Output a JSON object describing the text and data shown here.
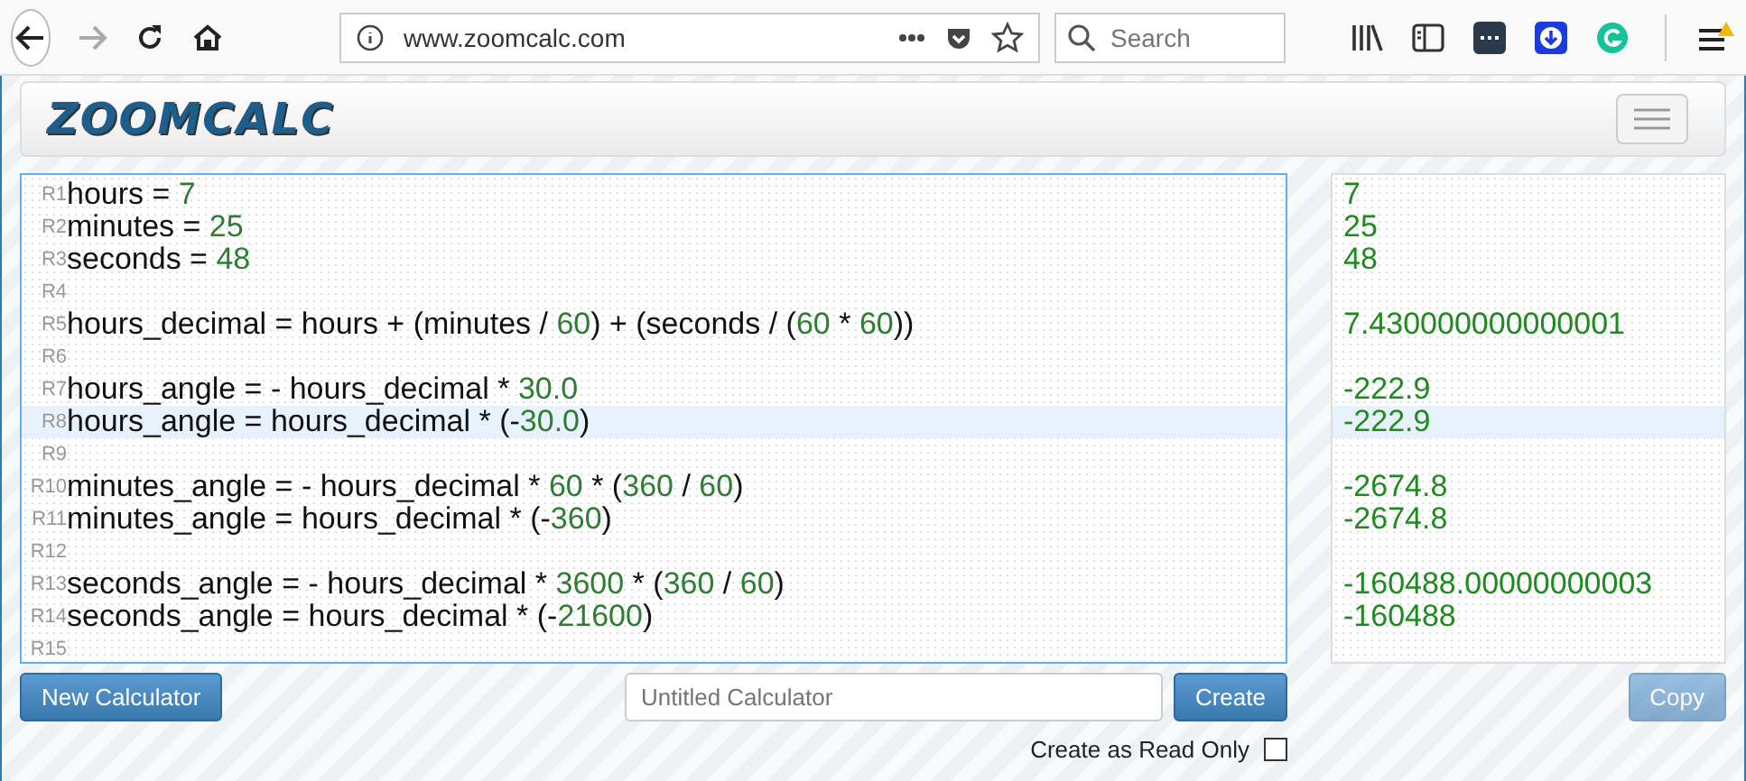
{
  "browser": {
    "url": "www.zoomcalc.com",
    "search_placeholder": "Search",
    "forward_disabled": true
  },
  "site": {
    "logo": "ZOOMCALC"
  },
  "editor": {
    "lines": [
      {
        "label": "R1",
        "selected": false,
        "parts": [
          {
            "kind": "code",
            "text": "hours = "
          },
          {
            "kind": "num",
            "text": "7"
          }
        ]
      },
      {
        "label": "R2",
        "selected": false,
        "parts": [
          {
            "kind": "code",
            "text": "minutes = "
          },
          {
            "kind": "num",
            "text": "25"
          }
        ]
      },
      {
        "label": "R3",
        "selected": false,
        "parts": [
          {
            "kind": "code",
            "text": "seconds = "
          },
          {
            "kind": "num",
            "text": "48"
          }
        ]
      },
      {
        "label": "R4",
        "selected": false
      },
      {
        "label": "R5",
        "selected": false,
        "parts": [
          {
            "kind": "code",
            "text": "hours_decimal = hours + (minutes / "
          },
          {
            "kind": "num",
            "text": "60"
          },
          {
            "kind": "code",
            "text": ") + (seconds / ("
          },
          {
            "kind": "num",
            "text": "60"
          },
          {
            "kind": "code",
            "text": " * "
          },
          {
            "kind": "num",
            "text": "60"
          },
          {
            "kind": "code",
            "text": "))"
          }
        ]
      },
      {
        "label": "R6",
        "selected": false
      },
      {
        "label": "R7",
        "selected": false,
        "parts": [
          {
            "kind": "code",
            "text": "hours_angle = - hours_decimal * "
          },
          {
            "kind": "num",
            "text": "30.0"
          }
        ]
      },
      {
        "label": "R8",
        "selected": true,
        "parts": [
          {
            "kind": "code",
            "text": "hours_angle = hours_decimal * (-"
          },
          {
            "kind": "num",
            "text": "30.0"
          },
          {
            "kind": "code",
            "text": ")"
          }
        ]
      },
      {
        "label": "R9",
        "selected": false
      },
      {
        "label": "R10",
        "selected": false,
        "parts": [
          {
            "kind": "code",
            "text": "minutes_angle = - hours_decimal * "
          },
          {
            "kind": "num",
            "text": "60"
          },
          {
            "kind": "code",
            "text": " * ("
          },
          {
            "kind": "num",
            "text": "360"
          },
          {
            "kind": "code",
            "text": " / "
          },
          {
            "kind": "num",
            "text": "60"
          },
          {
            "kind": "code",
            "text": ")"
          }
        ]
      },
      {
        "label": "R11",
        "selected": false,
        "parts": [
          {
            "kind": "code",
            "text": "minutes_angle = hours_decimal * (-"
          },
          {
            "kind": "num",
            "text": "360"
          },
          {
            "kind": "code",
            "text": ")"
          }
        ]
      },
      {
        "label": "R12",
        "selected": false
      },
      {
        "label": "R13",
        "selected": false,
        "parts": [
          {
            "kind": "code",
            "text": "seconds_angle = - hours_decimal * "
          },
          {
            "kind": "num",
            "text": "3600"
          },
          {
            "kind": "code",
            "text": " * ("
          },
          {
            "kind": "num",
            "text": "360"
          },
          {
            "kind": "code",
            "text": " / "
          },
          {
            "kind": "num",
            "text": "60"
          },
          {
            "kind": "code",
            "text": ")"
          }
        ]
      },
      {
        "label": "R14",
        "selected": false,
        "parts": [
          {
            "kind": "code",
            "text": "seconds_angle = hours_decimal * (-"
          },
          {
            "kind": "num",
            "text": "21600"
          },
          {
            "kind": "code",
            "text": ")"
          }
        ]
      },
      {
        "label": "R15",
        "selected": false
      }
    ]
  },
  "results": [
    {
      "text": "7",
      "selected": false
    },
    {
      "text": "25",
      "selected": false
    },
    {
      "text": "48",
      "selected": false
    },
    {
      "selected": false
    },
    {
      "text": "7.430000000000001",
      "selected": false
    },
    {
      "selected": false
    },
    {
      "text": "-222.9",
      "selected": false
    },
    {
      "text": "-222.9",
      "selected": true
    },
    {
      "selected": false
    },
    {
      "text": "-2674.8",
      "selected": false
    },
    {
      "text": "-2674.8",
      "selected": false
    },
    {
      "selected": false
    },
    {
      "text": "-160488.00000000003",
      "selected": false
    },
    {
      "text": "-160488",
      "selected": false
    },
    {
      "selected": false
    }
  ],
  "controls": {
    "new_button": "New Calculator",
    "name_placeholder": "Untitled Calculator",
    "create_button": "Create",
    "copy_button": {
      "label": "Copy",
      "disabled": true
    },
    "read_only": {
      "label": "Create as Read Only",
      "checked": false
    }
  }
}
